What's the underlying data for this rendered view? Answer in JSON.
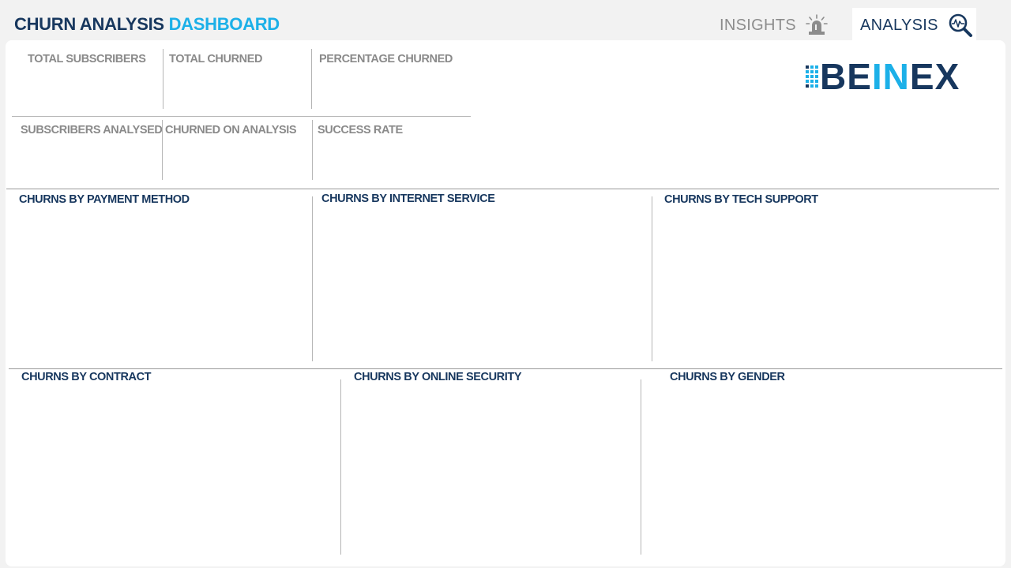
{
  "header": {
    "title_main": "CHURN ANALYSIS",
    "title_accent": "DASHBOARD"
  },
  "nav": {
    "insights": {
      "label": "INSIGHTS",
      "icon": "siren-icon"
    },
    "analysis": {
      "label": "ANALYSIS",
      "icon": "magnifier-pulse-icon"
    }
  },
  "logo": {
    "text_part1": "BE",
    "text_part2": "IN",
    "text_part3": "EX"
  },
  "kpis": {
    "total_subscribers": "TOTAL SUBSCRIBERS",
    "total_churned": "TOTAL CHURNED",
    "percentage_churned": "PERCENTAGE CHURNED",
    "subscribers_analysed": "SUBSCRIBERS ANALYSED",
    "churned_on_analysis": "CHURNED ON ANALYSIS",
    "success_rate": "SUCCESS RATE"
  },
  "charts": {
    "payment_method": "CHURNS BY PAYMENT METHOD",
    "internet_service": "CHURNS BY INTERNET SERVICE",
    "tech_support": "CHURNS BY TECH SUPPORT",
    "contract": "CHURNS BY CONTRACT",
    "online_security": "CHURNS BY ONLINE SECURITY",
    "gender": "CHURNS BY GENDER"
  },
  "colors": {
    "navy": "#17375e",
    "accent": "#1cb0e8",
    "muted": "#8a8a8a",
    "background": "#f2f2f2",
    "panel": "#ffffff"
  }
}
